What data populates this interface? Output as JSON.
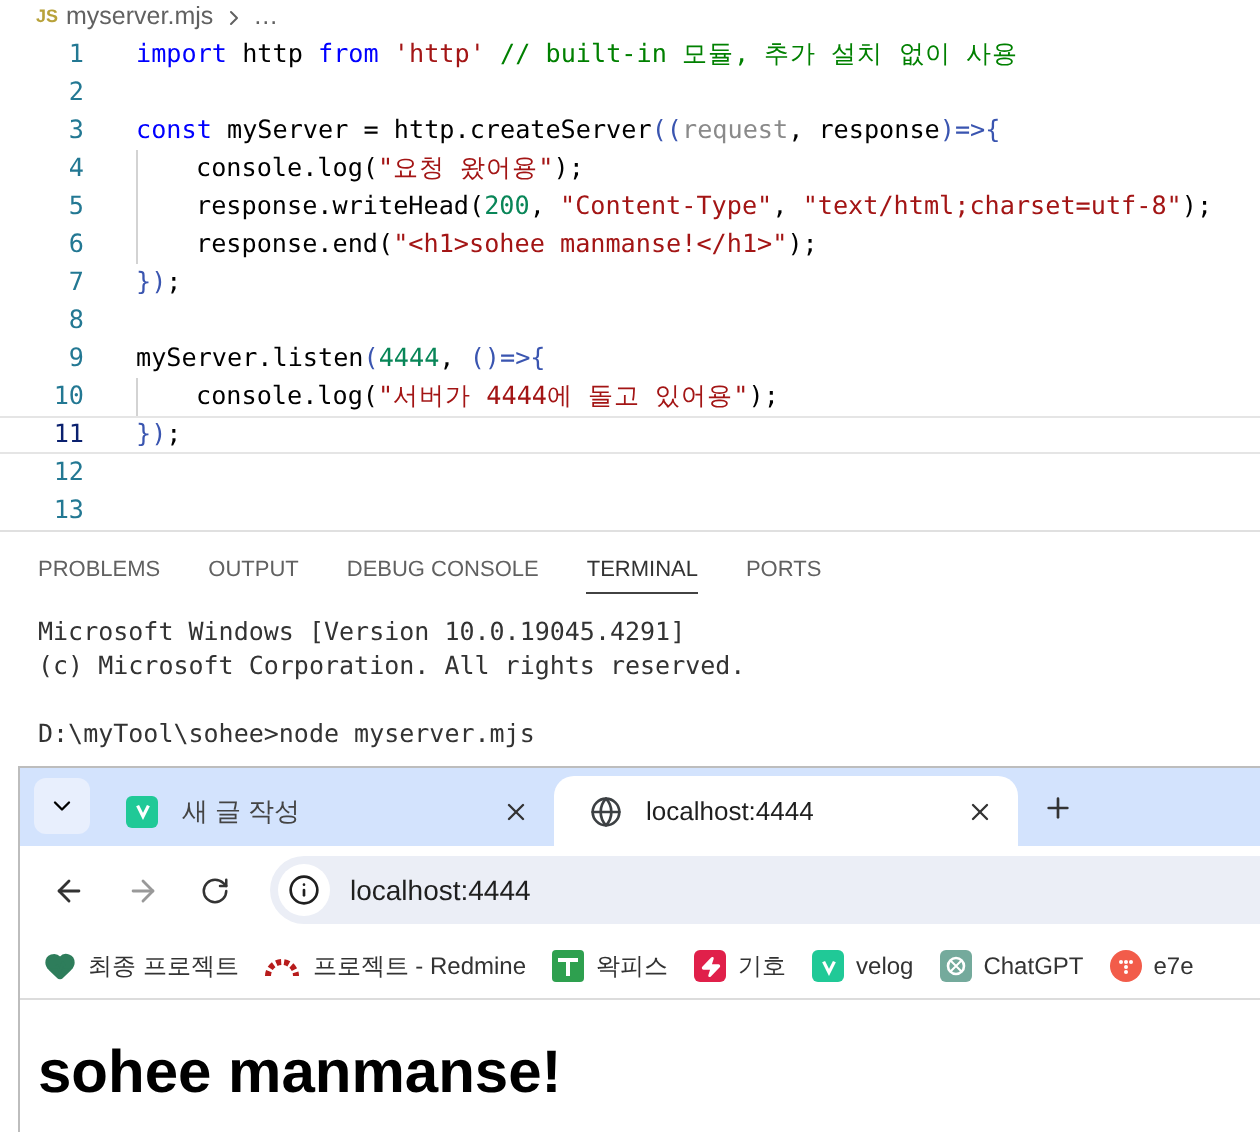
{
  "editor": {
    "breadcrumb": {
      "file_badge": "JS",
      "file": "myserver.mjs",
      "more": "…"
    },
    "lines": [
      {
        "number": "1",
        "current": false,
        "indent": false,
        "tokens": [
          {
            "t": "import",
            "kind": "keyword"
          },
          {
            "t": " http ",
            "kind": "plain"
          },
          {
            "t": "from",
            "kind": "keyword"
          },
          {
            "t": " 'http'",
            "kind": "string"
          },
          {
            "t": " // built-in 모듈, 추가 설치 없이 사용",
            "kind": "comment"
          }
        ]
      },
      {
        "number": "2",
        "current": false,
        "indent": false
      },
      {
        "number": "3",
        "current": false,
        "indent": false,
        "tokens": [
          {
            "t": "const",
            "kind": "keyword"
          },
          {
            "t": " myServer = http.createServer",
            "kind": "plain"
          },
          {
            "t": "((",
            "kind": "bracket"
          },
          {
            "t": "request",
            "kind": "param"
          },
          {
            "t": ", response",
            "kind": "plain"
          },
          {
            "t": ")=>{",
            "kind": "bracket"
          }
        ]
      },
      {
        "number": "4",
        "current": false,
        "indent": true,
        "tokens": [
          {
            "t": "console.log(",
            "kind": "plain"
          },
          {
            "t": "\"요청 왔어용\"",
            "kind": "string"
          },
          {
            "t": ");",
            "kind": "plain"
          }
        ]
      },
      {
        "number": "5",
        "current": false,
        "indent": true,
        "tokens": [
          {
            "t": "response.writeHead(",
            "kind": "plain"
          },
          {
            "t": "200",
            "kind": "number"
          },
          {
            "t": ", ",
            "kind": "plain"
          },
          {
            "t": "\"Content-Type\"",
            "kind": "string"
          },
          {
            "t": ", ",
            "kind": "plain"
          },
          {
            "t": "\"text/html;charset=utf-8\"",
            "kind": "string"
          },
          {
            "t": ");",
            "kind": "plain"
          }
        ]
      },
      {
        "number": "6",
        "current": false,
        "indent": true,
        "tokens": [
          {
            "t": "response.end(",
            "kind": "plain"
          },
          {
            "t": "\"<h1>sohee manmanse!</h1>\"",
            "kind": "string"
          },
          {
            "t": ");",
            "kind": "plain"
          }
        ]
      },
      {
        "number": "7",
        "current": false,
        "indent": false,
        "tokens": [
          {
            "t": "})",
            "kind": "bracket"
          },
          {
            "t": ";",
            "kind": "plain"
          }
        ]
      },
      {
        "number": "8",
        "current": false,
        "indent": false
      },
      {
        "number": "9",
        "current": false,
        "indent": false,
        "tokens": [
          {
            "t": "myServer.listen",
            "kind": "plain"
          },
          {
            "t": "(",
            "kind": "bracket"
          },
          {
            "t": "4444",
            "kind": "number"
          },
          {
            "t": ", ",
            "kind": "plain"
          },
          {
            "t": "()=>{",
            "kind": "bracket"
          }
        ]
      },
      {
        "number": "10",
        "current": false,
        "indent": true,
        "tokens": [
          {
            "t": "console.log(",
            "kind": "plain"
          },
          {
            "t": "\"서버가 4444에 돌고 있어용\"",
            "kind": "string"
          },
          {
            "t": ");",
            "kind": "plain"
          }
        ]
      },
      {
        "number": "11",
        "current": true,
        "indent": false,
        "tokens": [
          {
            "t": "})",
            "kind": "bracket"
          },
          {
            "t": ";",
            "kind": "plain"
          }
        ]
      },
      {
        "number": "12",
        "current": false,
        "indent": false
      },
      {
        "number": "13",
        "current": false,
        "indent": false
      }
    ]
  },
  "panel": {
    "tabs": [
      {
        "label": "PROBLEMS",
        "selected": false
      },
      {
        "label": "OUTPUT",
        "selected": false
      },
      {
        "label": "DEBUG CONSOLE",
        "selected": false
      },
      {
        "label": "TERMINAL",
        "selected": true
      },
      {
        "label": "PORTS",
        "selected": false
      }
    ],
    "terminal_blocks": [
      [
        "Microsoft Windows [Version 10.0.19045.4291]",
        "(c) Microsoft Corporation. All rights reserved."
      ],
      [
        "D:\\myTool\\sohee>node myserver.mjs"
      ]
    ]
  },
  "browser": {
    "tabs": [
      {
        "label": "새 글 작성",
        "kind": "velog",
        "selected": false
      },
      {
        "label": "localhost:4444",
        "kind": "globe",
        "selected": true
      }
    ],
    "address": "localhost:4444",
    "bookmarks": [
      {
        "label": "최종 프로젝트",
        "kind": "heart"
      },
      {
        "label": "프로젝트 - Redmine",
        "kind": "arc"
      },
      {
        "label": "왁피스",
        "kind": "sheet"
      },
      {
        "label": "기호",
        "kind": "bolt"
      },
      {
        "label": "velog",
        "kind": "velog"
      },
      {
        "label": "ChatGPT",
        "kind": "chatgpt"
      },
      {
        "label": "e7e",
        "kind": "dots"
      }
    ],
    "heading": "sohee manmanse!"
  }
}
